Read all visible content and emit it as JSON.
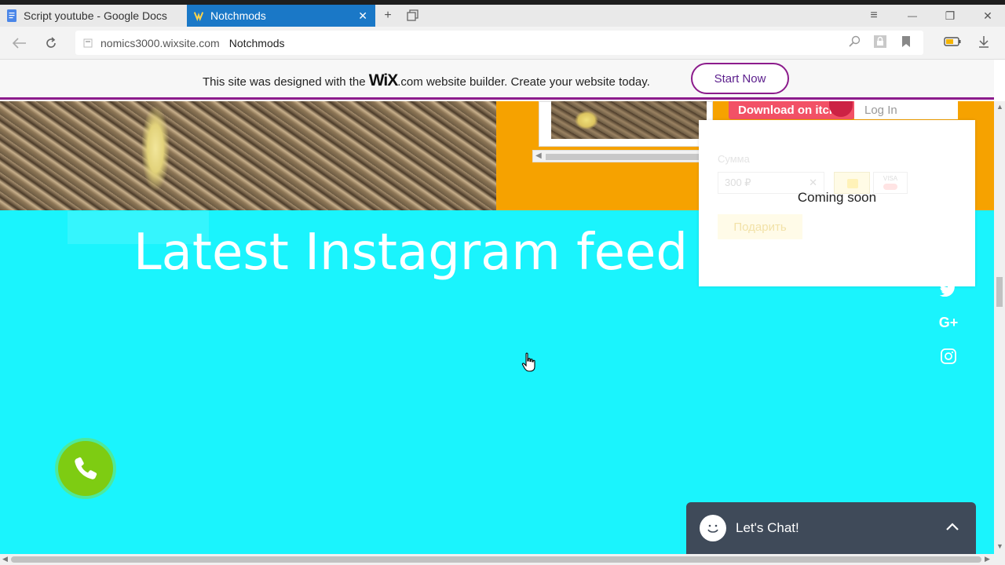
{
  "browser": {
    "tabs": [
      {
        "label": "Script youtube - Google Docs",
        "active": false
      },
      {
        "label": "Notchmods",
        "active": true
      }
    ],
    "tab_close": "✕",
    "new_tab": "+",
    "window_menu": "≡",
    "window_min": "—",
    "window_restore": "❐",
    "window_close": "✕",
    "address": {
      "host": "nomics3000.wixsite.com",
      "title": "Notchmods"
    },
    "accent_color": "#1a78c7"
  },
  "wix_banner": {
    "text_before": "This site was designed with the ",
    "logo": "WiX",
    "text_after": ".com website builder. Create your website today.",
    "cta_label": "Start Now",
    "border_color": "#8c1c8c"
  },
  "itch_widget": {
    "download_label": "Download on itch",
    "login_label": "Log In"
  },
  "donate_widget": {
    "sum_label": "Сумма",
    "amount_value": "300 ₽",
    "clear_icon": "✕",
    "card_label": "VISA",
    "coming_soon": "Coming soon",
    "submit_label": "Подарить"
  },
  "page": {
    "background_color": "#1af4fd",
    "section_title": "Latest Instagram feed"
  },
  "social": {
    "google_plus": "G+"
  },
  "chat": {
    "label": "Let's Chat!",
    "bar_color": "#3f4a59"
  },
  "call_button_color": "#7ecc12"
}
